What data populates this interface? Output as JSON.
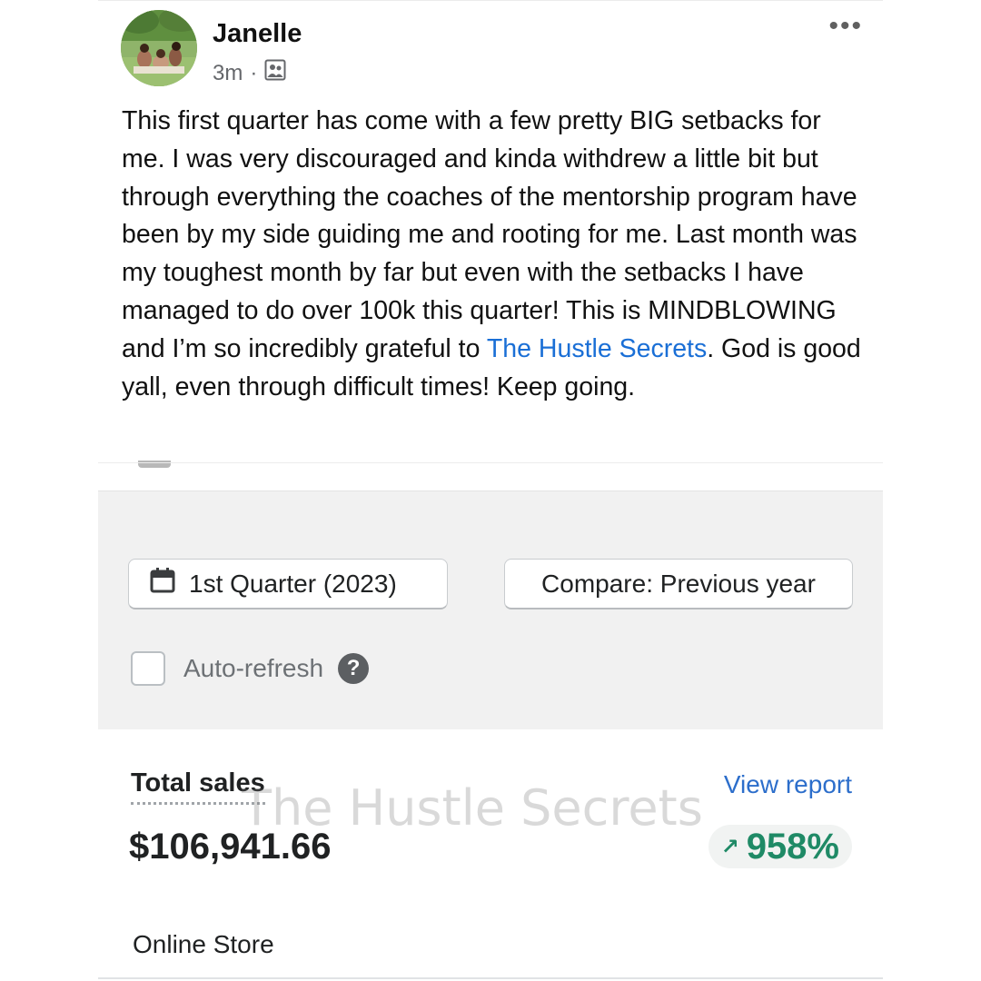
{
  "post": {
    "author": "Janelle",
    "time": "3m",
    "separator": "·",
    "visibility_icon": "group-members-icon",
    "more_label": "•••",
    "text_before_link": "This first quarter has come with a few pretty BIG setbacks for me. I was very discouraged and kinda withdrew a little bit but through everything the coaches of the mentorship program have been by my side guiding me and rooting for me. Last month was my toughest month by far but even with the setbacks I have managed to do over 100k this quarter! This is MINDBLOWING and I’m so incredibly grateful to ",
    "link_text": "The Hustle Secrets",
    "text_after_link": ". God is good yall, even through difficult times! Keep going."
  },
  "report": {
    "date_range_label": "1st Quarter (2023)",
    "date_icon": "calendar-icon",
    "compare_label": "Compare: Previous year",
    "auto_refresh_label": "Auto-refresh",
    "auto_refresh_checked": false,
    "help_label": "?",
    "total_sales_label": "Total sales",
    "view_report_label": "View report",
    "total_sales_value": "$106,941.66",
    "change_arrow": "↗",
    "change_percent": "958%",
    "channel_label": "Online Store",
    "watermark": "The Hustle Secrets"
  },
  "colors": {
    "link": "#1a6fd6",
    "positive": "#1f8a66",
    "view_report": "#2c6ecb",
    "filter_panel_bg": "#f1f1f1"
  }
}
